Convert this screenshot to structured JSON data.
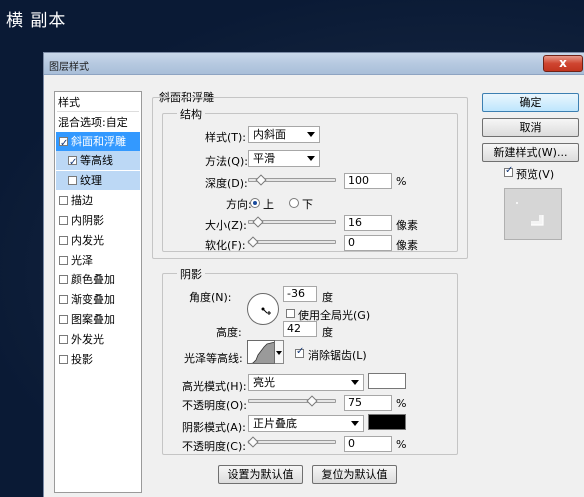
{
  "page": {
    "title": "横 副本"
  },
  "dialog": {
    "title": "图层样式",
    "close_label": "x"
  },
  "sidebar": {
    "header": "样式",
    "blend_label": "混合选项:自定",
    "items": [
      {
        "label": "斜面和浮雕",
        "checked": true
      },
      {
        "label": "等高线",
        "checked": true
      },
      {
        "label": "纹理",
        "checked": false
      },
      {
        "label": "描边",
        "checked": false
      },
      {
        "label": "内阴影",
        "checked": false
      },
      {
        "label": "内发光",
        "checked": false
      },
      {
        "label": "光泽",
        "checked": false
      },
      {
        "label": "颜色叠加",
        "checked": false
      },
      {
        "label": "渐变叠加",
        "checked": false
      },
      {
        "label": "图案叠加",
        "checked": false
      },
      {
        "label": "外发光",
        "checked": false
      },
      {
        "label": "投影",
        "checked": false
      }
    ]
  },
  "bevel": {
    "section_title": "斜面和浮雕",
    "structure": {
      "title": "结构",
      "style_label": "样式(T):",
      "style_value": "内斜面",
      "method_label": "方法(Q):",
      "method_value": "平滑",
      "depth_label": "深度(D):",
      "depth_value": "100",
      "depth_unit": "%",
      "depth_level": 0.1,
      "direction_label": "方向:",
      "direction_up": "上",
      "direction_down": "下",
      "size_label": "大小(Z):",
      "size_value": "16",
      "size_unit": "像素",
      "size_level": 0.06,
      "soften_label": "软化(F):",
      "soften_value": "0",
      "soften_unit": "像素",
      "soften_level": 0.0
    },
    "shading": {
      "title": "阴影",
      "angle_label": "角度(N):",
      "angle_value": "-36",
      "angle_unit": "度",
      "global_light_label": "使用全局光(G)",
      "global_light_checked": false,
      "altitude_label": "高度:",
      "altitude_value": "42",
      "altitude_unit": "度",
      "gloss_label": "光泽等高线:",
      "antialias_label": "消除锯齿(L)",
      "antialias_checked": true,
      "highlight_mode_label": "高光模式(H):",
      "highlight_mode_value": "亮光",
      "highlight_color": "#ffffff",
      "highlight_opacity_label": "不透明度(O):",
      "highlight_opacity_value": "75",
      "highlight_opacity_unit": "%",
      "highlight_opacity_level": 0.75,
      "shadow_mode_label": "阴影模式(A):",
      "shadow_mode_value": "正片叠底",
      "shadow_color": "#000000",
      "shadow_opacity_label": "不透明度(C):",
      "shadow_opacity_value": "0",
      "shadow_opacity_unit": "%",
      "shadow_opacity_level": 0.0
    },
    "set_default_label": "设置为默认值",
    "reset_default_label": "复位为默认值"
  },
  "actions": {
    "ok_label": "确定",
    "cancel_label": "取消",
    "new_style_label": "新建样式(W)...",
    "preview_label": "预览(V)",
    "preview_checked": true
  }
}
